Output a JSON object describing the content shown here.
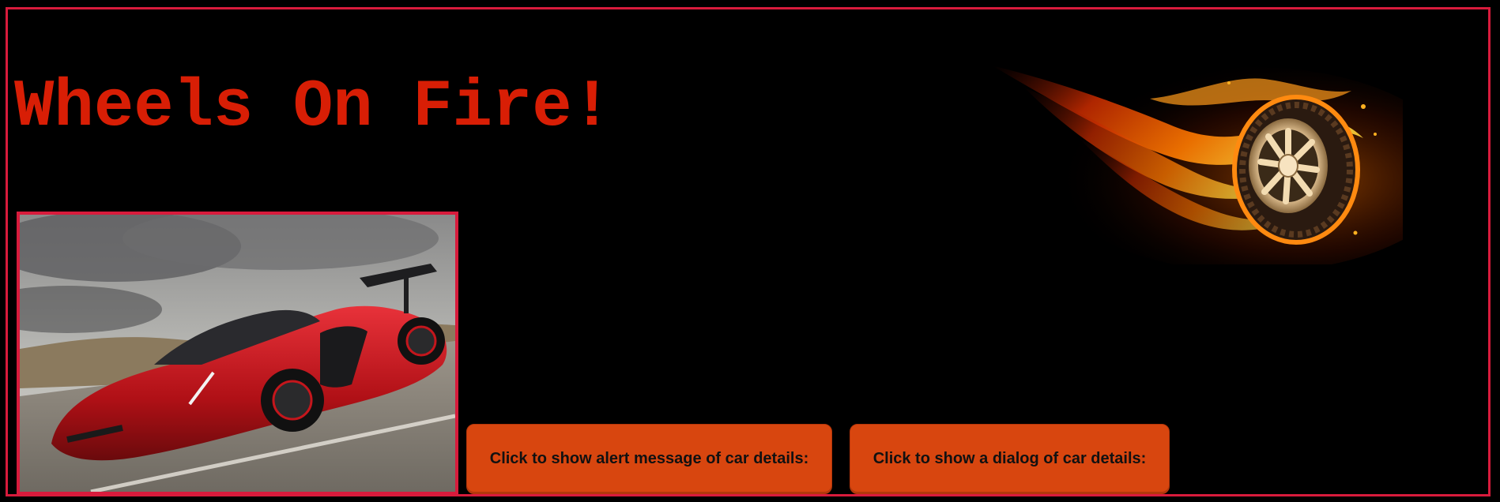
{
  "page": {
    "title": "Wheels On Fire!"
  },
  "buttons": {
    "alert_label": "Click to show alert message of car details:",
    "dialog_label": "Click to show a dialog of car details:"
  },
  "colors": {
    "background": "#000000",
    "frame_border": "#d81b3c",
    "title_text": "#d81e05",
    "button_fill": "#d8460f",
    "car_body": "#c4161c"
  },
  "images": {
    "flaming_wheel": "flaming-wheel-icon",
    "car_photo": "red-sports-car-photo"
  }
}
